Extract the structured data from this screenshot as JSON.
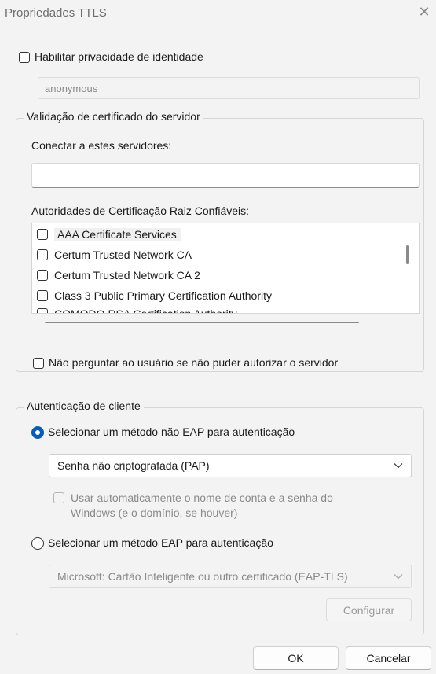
{
  "window": {
    "title": "Propriedades TTLS",
    "close_symbol": "✕"
  },
  "identity_privacy": {
    "checkbox_label": "Habilitar privacidade de identidade",
    "checked": false,
    "value": "anonymous"
  },
  "server_validation": {
    "legend": "Validação de certificado do servidor",
    "connect_label": "Conectar a estes servidores:",
    "connect_value": "",
    "ca_label": "Autoridades de Certificação Raiz Confiáveis:",
    "ca_items": [
      {
        "label": "AAA Certificate Services",
        "checked": false
      },
      {
        "label": "Certum Trusted Network CA",
        "checked": false
      },
      {
        "label": "Certum Trusted Network CA 2",
        "checked": false
      },
      {
        "label": "Class 3 Public Primary Certification Authority",
        "checked": false
      },
      {
        "label": "COMODO RSA Certification Authority",
        "checked": false
      }
    ],
    "dont_prompt_label": "Não perguntar ao usuário se não puder autorizar o servidor",
    "dont_prompt_checked": false
  },
  "client_auth": {
    "legend": "Autenticação de cliente",
    "non_eap_label": "Selecionar um método não EAP para autenticação",
    "non_eap_selected": true,
    "non_eap_method": "Senha não criptografada (PAP)",
    "auto_windows_label_line1": "Usar automaticamente o nome de conta e a senha do",
    "auto_windows_label_line2": "Windows (e o domínio, se houver)",
    "eap_label": "Selecionar um método EAP para autenticação",
    "eap_selected": false,
    "eap_method": "Microsoft: Cartão Inteligente ou outro certificado (EAP-TLS)",
    "configure_label": "Configurar"
  },
  "footer": {
    "ok_label": "OK",
    "cancel_label": "Cancelar"
  },
  "colors": {
    "accent": "#0b5cad",
    "background": "#f3f3f3"
  }
}
